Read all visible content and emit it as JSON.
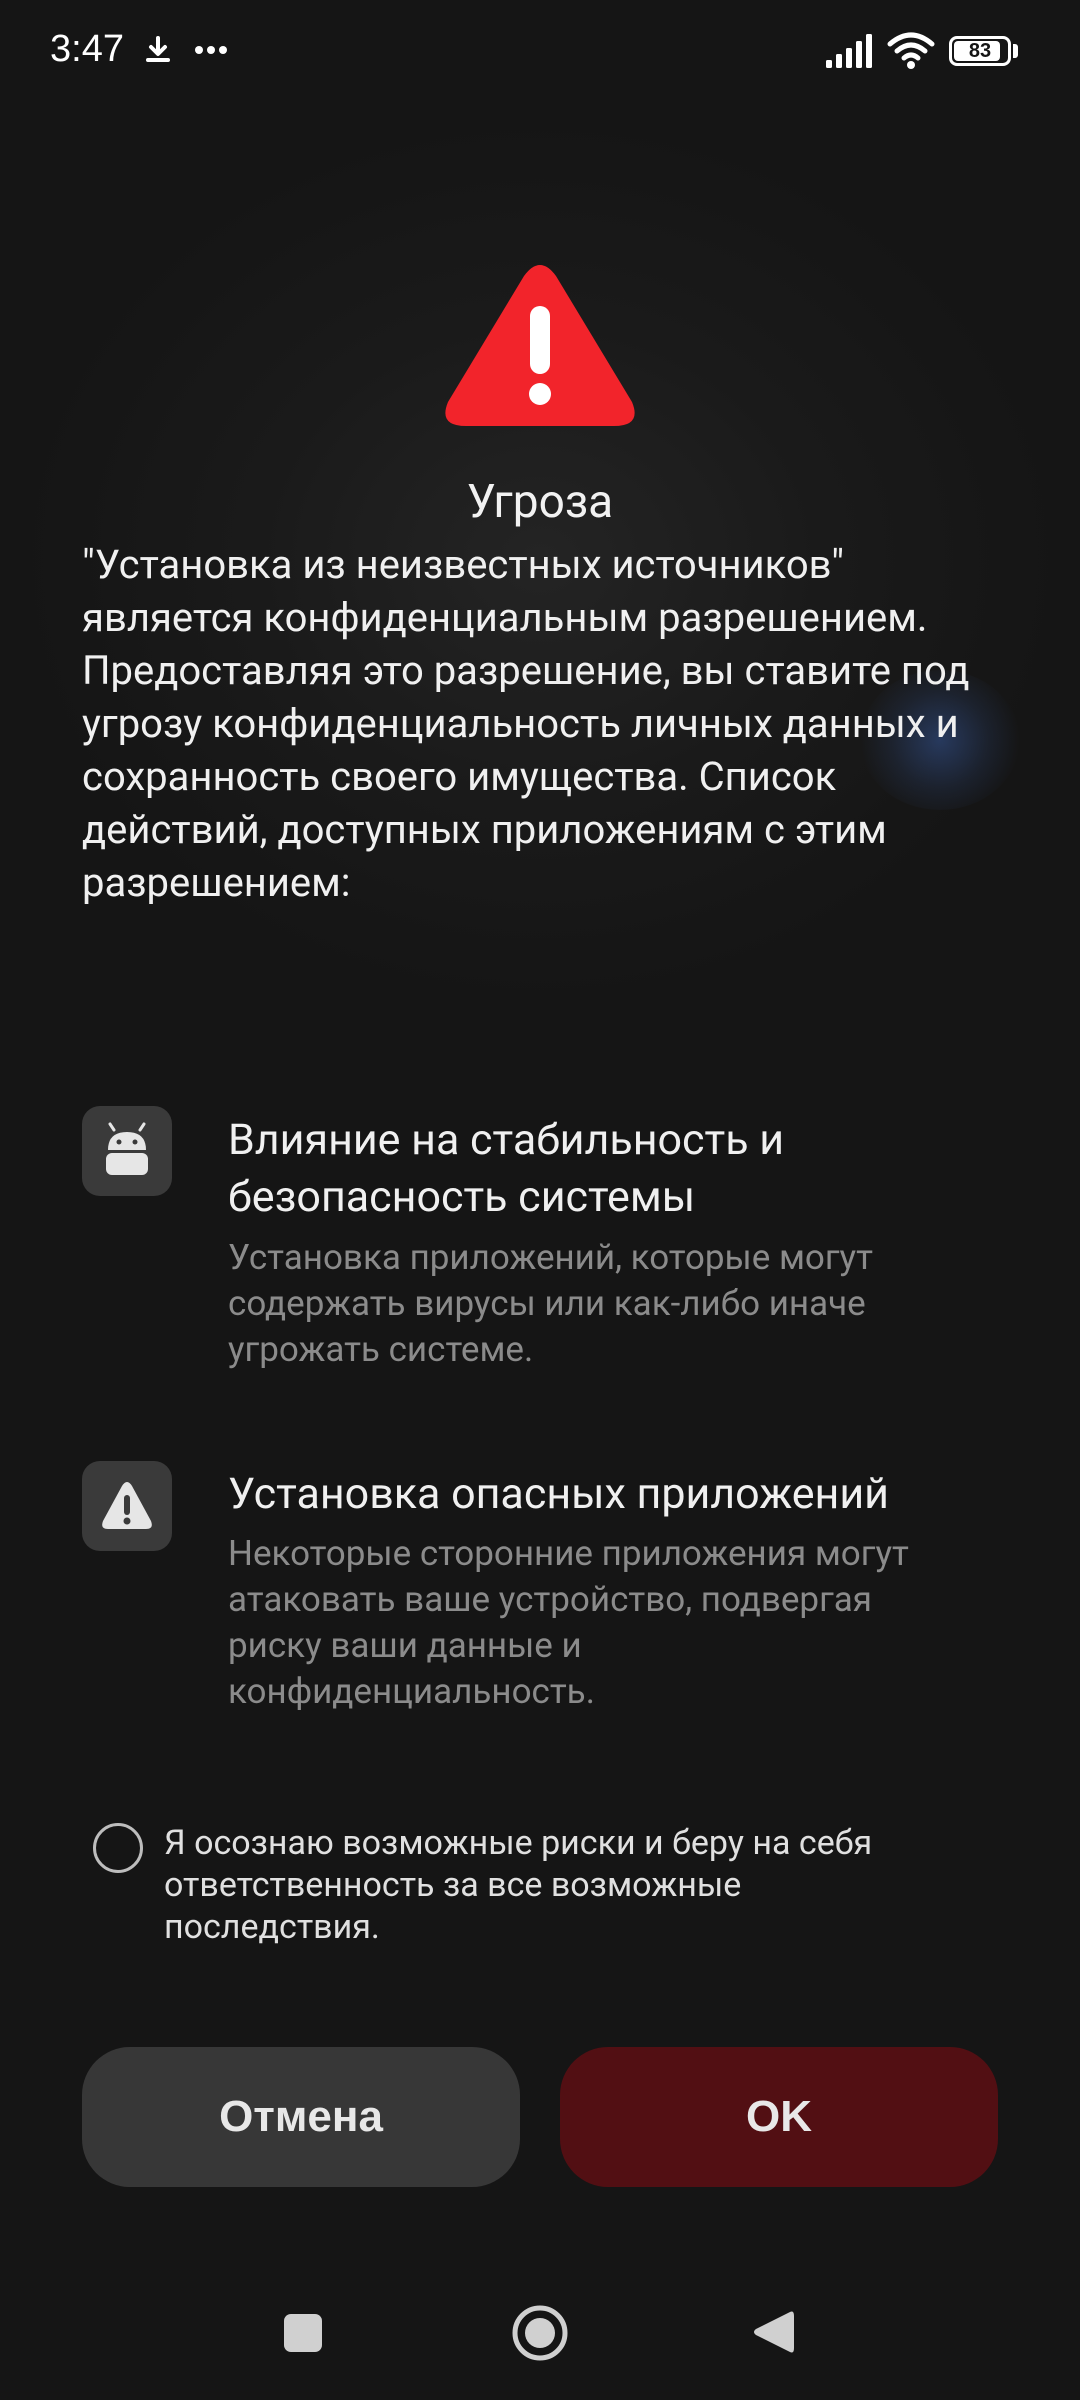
{
  "status_bar": {
    "time": "3:47",
    "battery_level": "83",
    "icons": [
      "download-icon",
      "more-dots-icon",
      "signal-icon",
      "wifi-icon",
      "battery-icon"
    ]
  },
  "dialog": {
    "icon": "warning-triangle-icon",
    "title": "Угроза",
    "description": "\"Установка из неизвестных источников\" является конфиденциальным разрешением. Предоставляя это разрешение, вы ставите под угрозу конфиденциальность личных данных и сохранность своего имущества. Список действий, доступных приложениям с этим разрешением:",
    "permissions": [
      {
        "icon": "android-icon",
        "title": "Влияние на стабильность и безопасность системы",
        "description": "Установка приложений, которые могут содержать вирусы или как-либо иначе угрожать системе."
      },
      {
        "icon": "alert-icon",
        "title": "Установка опасных приложений",
        "description": "Некоторые сторонние приложения могут атаковать ваше устройство, подвергая риску ваши данные и конфиденциальность."
      }
    ],
    "consent_label": "Я осознаю возможные риски и беру на себя ответственность за все возможные последствия.",
    "consent_checked": false,
    "buttons": {
      "cancel": "Отмена",
      "ok": "OK"
    }
  },
  "colors": {
    "background": "#151515",
    "warning_red": "#f2242b",
    "ok_button": "#520f13",
    "cancel_button": "#373737",
    "secondary_text": "#8b8b8b"
  },
  "nav_bar": {
    "buttons": [
      "recents-square-icon",
      "home-circle-icon",
      "back-triangle-icon"
    ]
  }
}
